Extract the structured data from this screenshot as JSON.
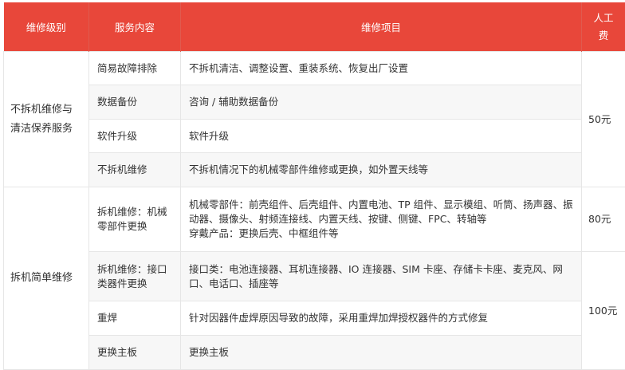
{
  "headers": [
    "维修级别",
    "服务内容",
    "维修项目",
    "人工费"
  ],
  "groups": [
    {
      "level": "不拆机维修与清洁保养服务",
      "rows": [
        {
          "service": "简易故障排除",
          "items": [
            "不拆机清洁、调整设置、重装系统、恢复出厂设置"
          ]
        },
        {
          "service": "数据备份",
          "items": [
            "咨询 / 辅助数据备份"
          ]
        },
        {
          "service": "软件升级",
          "items": [
            "软件升级"
          ]
        },
        {
          "service": "不拆机维修",
          "items": [
            "不拆机情况下的机械零部件维修或更换，如外置天线等"
          ]
        }
      ],
      "fee": "50元"
    },
    {
      "level": "拆机简单维修",
      "rows": [
        {
          "service": "拆机维修：机械零部件更换",
          "items": [
            "机械零部件：前壳组件、后壳组件、内置电池、TP 组件、显示模组、听筒、扬声器、振动器、摄像头、射频连接线、内置天线、按键、侧键、FPC、转轴等",
            "穿戴产品：更换后壳、中框组件等"
          ]
        },
        {
          "service": "拆机维修：接口类器件更换",
          "items": [
            "接口类：电池连接器、耳机连接器、IO 连接器、SIM 卡座、存储卡卡座、麦克风、网口、电话口、插座等"
          ]
        },
        {
          "service": "重焊",
          "items": [
            "针对因器件虚焊原因导致的故障，采用重焊加焊授权器件的方式修复"
          ]
        },
        {
          "service": "更换主板",
          "items": [
            "更换主板"
          ]
        }
      ],
      "fees": [
        "80元",
        "100元"
      ]
    }
  ]
}
